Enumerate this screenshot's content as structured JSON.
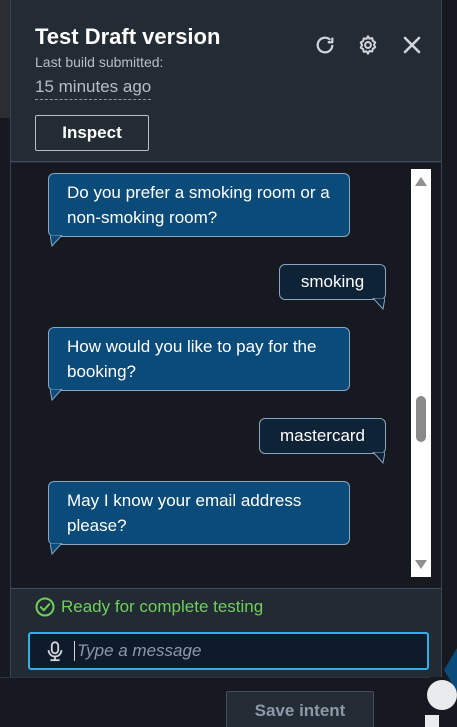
{
  "panel": {
    "title": "Test Draft version",
    "build_label": "Last build submitted:",
    "build_time": "15 minutes ago",
    "inspect_label": "Inspect",
    "icons": [
      "refresh-icon",
      "gear-icon",
      "close-icon"
    ]
  },
  "chat": {
    "messages": [
      {
        "from": "bot",
        "text": "Do you prefer a smoking room or a non-smoking room?"
      },
      {
        "from": "user",
        "text": "smoking"
      },
      {
        "from": "bot",
        "text": "How would you like to pay for the booking?"
      },
      {
        "from": "user",
        "text": "mastercard"
      },
      {
        "from": "bot",
        "text": "May I know your email address please?"
      }
    ],
    "scroll_position": 0.6
  },
  "status": {
    "text": "Ready for complete testing",
    "color": "#6fcf5a"
  },
  "input": {
    "placeholder": "Type a message",
    "value": ""
  },
  "footer": {
    "save_label": "Save intent"
  },
  "colors": {
    "bot_bubble": "#0b4b7a",
    "user_bubble": "#0f2336",
    "accent": "#2fb0e6"
  }
}
